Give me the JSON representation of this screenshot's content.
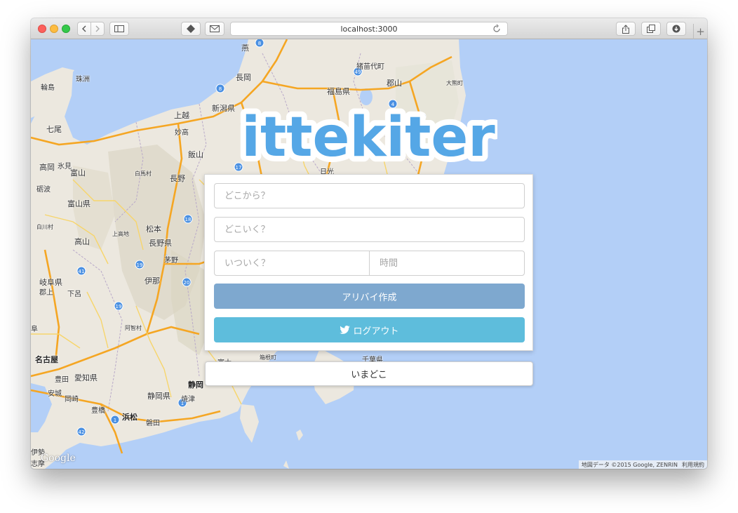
{
  "browser": {
    "url": "localhost:3000",
    "new_tab_label": "+"
  },
  "map": {
    "labels": [
      "燕",
      "猪苗代町",
      "輪島",
      "珠洲",
      "長岡",
      "福島県",
      "郡山",
      "大熊町",
      "新潟県",
      "上越",
      "七尾",
      "妙高",
      "飯山",
      "氷見",
      "高岡",
      "富山",
      "白馬村",
      "長野",
      "日光",
      "砺波",
      "富山県",
      "白川村",
      "松本",
      "上高地",
      "高山",
      "長野県",
      "茅野",
      "岐阜県",
      "郡上",
      "下呂",
      "伊那",
      "阜",
      "阿智村",
      "名古屋",
      "豊田",
      "愛知県",
      "安城",
      "岡崎",
      "豊橋",
      "浜松",
      "磐田",
      "静岡県",
      "静岡",
      "焼津",
      "伊勢",
      "志摩",
      "千葉県",
      "富士",
      "箱根町"
    ],
    "route_numbers": [
      "8",
      "49",
      "4",
      "49",
      "8",
      "17",
      "18",
      "19",
      "41",
      "20",
      "19",
      "1",
      "1",
      "42"
    ],
    "google": "Google",
    "attribution": "地図データ ©2015 Google, ZENRIN",
    "terms": "利用規約"
  },
  "app": {
    "logo_text": "ittekiter",
    "from_placeholder": "どこから？",
    "to_placeholder": "どこいく？",
    "date_placeholder": "いついく？",
    "time_placeholder": "時間",
    "create_label": "アリバイ作成",
    "logout_label": "ログアウト",
    "now_label": "いまどこ"
  },
  "colors": {
    "logo": "#55a7e6",
    "create_button": "#7ea8cf",
    "logout_button": "#5ebddc",
    "sea": "#b3cff7",
    "land": "#ece8df"
  }
}
